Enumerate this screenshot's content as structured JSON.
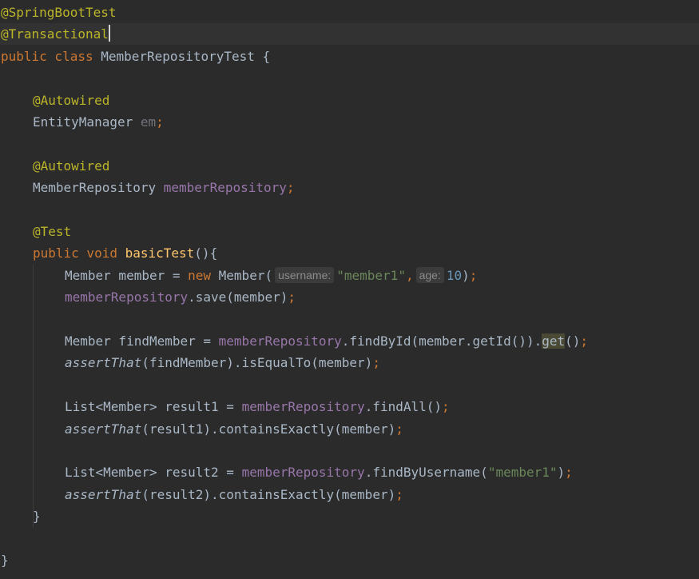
{
  "colors": {
    "background": "#2b2b2b",
    "current_line": "#323232",
    "default_text": "#a9b7c6",
    "keyword": "#cc7832",
    "annotation": "#bbb529",
    "field": "#9876aa",
    "method_declaration": "#ffc66d",
    "string": "#6a8759",
    "number": "#6897bb",
    "unused": "#72737a",
    "hint_background": "#3b3b3b",
    "hint_text": "#8c8c8c",
    "matched_highlight": "#4a4a34"
  },
  "editor": {
    "lines": [
      {
        "indent": 0,
        "tokens": [
          {
            "text": "@SpringBootTest",
            "kind": "annotation"
          }
        ]
      },
      {
        "indent": 0,
        "current": true,
        "tokens": [
          {
            "text": "@Transactional",
            "kind": "annotation",
            "caret_after": true
          }
        ]
      },
      {
        "indent": 0,
        "tokens": [
          {
            "text": "public class ",
            "kind": "keyword"
          },
          {
            "text": "MemberRepositoryTest {",
            "kind": "plain"
          }
        ]
      },
      {
        "indent": 0,
        "tokens": []
      },
      {
        "indent": 1,
        "tokens": [
          {
            "text": "@Autowired",
            "kind": "annotation"
          }
        ]
      },
      {
        "indent": 1,
        "tokens": [
          {
            "text": "EntityManager ",
            "kind": "plain"
          },
          {
            "text": "em",
            "kind": "unused"
          },
          {
            "text": ";",
            "kind": "keyword"
          }
        ]
      },
      {
        "indent": 0,
        "tokens": []
      },
      {
        "indent": 1,
        "tokens": [
          {
            "text": "@Autowired",
            "kind": "annotation"
          }
        ]
      },
      {
        "indent": 1,
        "tokens": [
          {
            "text": "MemberRepository ",
            "kind": "plain"
          },
          {
            "text": "memberRepository",
            "kind": "field"
          },
          {
            "text": ";",
            "kind": "keyword"
          }
        ]
      },
      {
        "indent": 0,
        "tokens": []
      },
      {
        "indent": 1,
        "tokens": [
          {
            "text": "@Test",
            "kind": "annotation"
          }
        ]
      },
      {
        "indent": 1,
        "tokens": [
          {
            "text": "public void ",
            "kind": "keyword"
          },
          {
            "text": "basicTest",
            "kind": "method_declaration"
          },
          {
            "text": "(){",
            "kind": "plain"
          }
        ]
      },
      {
        "indent": 2,
        "tokens": [
          {
            "text": "Member member = ",
            "kind": "plain"
          },
          {
            "text": "new ",
            "kind": "keyword"
          },
          {
            "text": "Member(",
            "kind": "plain"
          },
          {
            "text": "username:",
            "kind": "hint"
          },
          {
            "text": "\"member1\"",
            "kind": "string"
          },
          {
            "text": ",",
            "kind": "keyword"
          },
          {
            "text": "age:",
            "kind": "hint"
          },
          {
            "text": "10",
            "kind": "number"
          },
          {
            "text": ")",
            "kind": "plain"
          },
          {
            "text": ";",
            "kind": "keyword"
          }
        ]
      },
      {
        "indent": 2,
        "tokens": [
          {
            "text": "memberRepository",
            "kind": "field"
          },
          {
            "text": ".save(member)",
            "kind": "plain"
          },
          {
            "text": ";",
            "kind": "keyword"
          }
        ]
      },
      {
        "indent": 0,
        "tokens": []
      },
      {
        "indent": 2,
        "tokens": [
          {
            "text": "Member findMember = ",
            "kind": "plain"
          },
          {
            "text": "memberRepository",
            "kind": "field"
          },
          {
            "text": ".findById(member.getId()).",
            "kind": "plain"
          },
          {
            "text": "get",
            "kind": "matched"
          },
          {
            "text": "()",
            "kind": "plain"
          },
          {
            "text": ";",
            "kind": "keyword"
          }
        ]
      },
      {
        "indent": 2,
        "tokens": [
          {
            "text": "assertThat",
            "kind": "static_method"
          },
          {
            "text": "(findMember).isEqualTo(member)",
            "kind": "plain"
          },
          {
            "text": ";",
            "kind": "keyword"
          }
        ]
      },
      {
        "indent": 0,
        "tokens": []
      },
      {
        "indent": 2,
        "tokens": [
          {
            "text": "List<Member> result1 = ",
            "kind": "plain"
          },
          {
            "text": "memberRepository",
            "kind": "field"
          },
          {
            "text": ".findAll()",
            "kind": "plain"
          },
          {
            "text": ";",
            "kind": "keyword"
          }
        ]
      },
      {
        "indent": 2,
        "tokens": [
          {
            "text": "assertThat",
            "kind": "static_method"
          },
          {
            "text": "(result1).containsExactly(member)",
            "kind": "plain"
          },
          {
            "text": ";",
            "kind": "keyword"
          }
        ]
      },
      {
        "indent": 0,
        "tokens": []
      },
      {
        "indent": 2,
        "tokens": [
          {
            "text": "List<Member> result2 = ",
            "kind": "plain"
          },
          {
            "text": "memberRepository",
            "kind": "field"
          },
          {
            "text": ".findByUsername(",
            "kind": "plain"
          },
          {
            "text": "\"member1\"",
            "kind": "string"
          },
          {
            "text": ")",
            "kind": "plain"
          },
          {
            "text": ";",
            "kind": "keyword"
          }
        ]
      },
      {
        "indent": 2,
        "tokens": [
          {
            "text": "assertThat",
            "kind": "static_method"
          },
          {
            "text": "(result2).containsExactly(member)",
            "kind": "plain"
          },
          {
            "text": ";",
            "kind": "keyword"
          }
        ]
      },
      {
        "indent": 1,
        "tokens": [
          {
            "text": "}",
            "kind": "plain"
          }
        ]
      },
      {
        "indent": 0,
        "tokens": []
      },
      {
        "indent": 0,
        "tokens": [
          {
            "text": "}",
            "kind": "plain"
          }
        ]
      }
    ]
  }
}
